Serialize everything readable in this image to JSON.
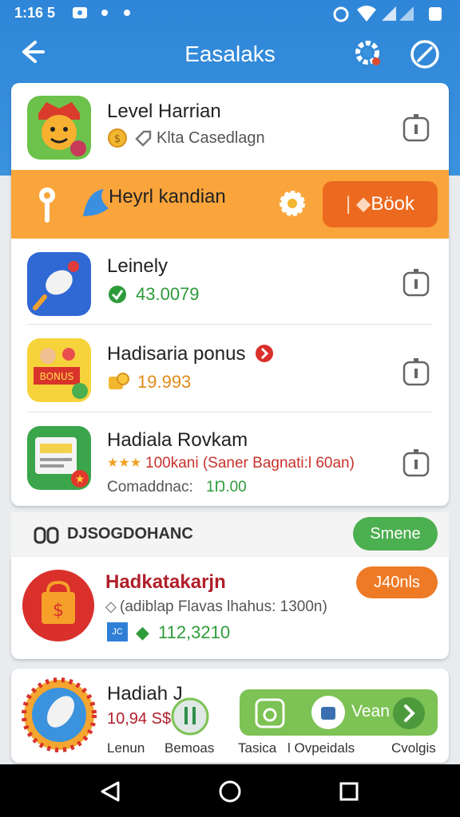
{
  "status": {
    "time": "1:16 5"
  },
  "appbar": {
    "title": "Easalaks",
    "back_icon": "arrow-left-icon",
    "gear_icon": "gear-icon",
    "compass_icon": "compass-icon"
  },
  "list": [
    {
      "title": "Level Harrian",
      "sub": "Klta Casedlagn"
    },
    {
      "title": "Leinely",
      "sub": "43.0079"
    },
    {
      "title": "Hadisaria ponus",
      "sub": "19.993"
    },
    {
      "title": "Hadiala Rovkam",
      "sub": "100kani (Saner Bagnati:l 60an)",
      "sub2_label": "Comaddnac:",
      "sub2_value": "1Ŋ.00",
      "stars": "★★★"
    }
  ],
  "promo": {
    "title": "Heyrl kandian",
    "button": "Böok"
  },
  "section": {
    "title": "DJSOGDOHANC",
    "button": "Smene"
  },
  "featured": {
    "title": "Hadkatakarjn",
    "badge": "J40nls",
    "sub": "(adiblap Flavas lhahus: 1300n)",
    "value": "112,3210",
    "icon_text": "JC"
  },
  "bottom": {
    "title": "Hadiah J",
    "value": "10,94 S$",
    "labels": [
      "Lenun",
      "Bemoas",
      "Tasica",
      "l Ovpeidals",
      "Cvolgis"
    ],
    "bar_label": "Vean"
  },
  "colors": {
    "header": "#3b92dd",
    "promo": "#f9a53c",
    "accent": "#ec6a1f",
    "green": "#4caf50"
  }
}
